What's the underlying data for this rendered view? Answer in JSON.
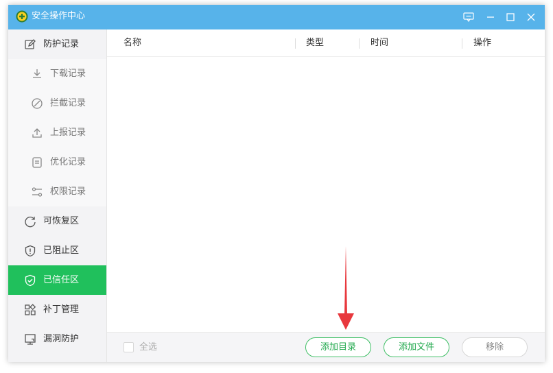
{
  "window": {
    "title": "安全操作中心",
    "colors": {
      "titlebar": "#57b3ea",
      "active": "#20c05c",
      "button_green": "#3fbf65"
    }
  },
  "sidebar": {
    "items": [
      {
        "label": "防护记录",
        "icon": "edit-icon",
        "level": "main"
      },
      {
        "label": "下载记录",
        "icon": "download-icon",
        "level": "sub"
      },
      {
        "label": "拦截记录",
        "icon": "block-icon",
        "level": "sub"
      },
      {
        "label": "上报记录",
        "icon": "upload-icon",
        "level": "sub"
      },
      {
        "label": "优化记录",
        "icon": "document-icon",
        "level": "sub"
      },
      {
        "label": "权限记录",
        "icon": "sliders-icon",
        "level": "sub"
      },
      {
        "label": "可恢复区",
        "icon": "refresh-icon",
        "level": "main"
      },
      {
        "label": "已阻止区",
        "icon": "shield-alert-icon",
        "level": "main"
      },
      {
        "label": "已信任区",
        "icon": "shield-check-icon",
        "level": "main",
        "active": true
      },
      {
        "label": "补丁管理",
        "icon": "apps-grid-icon",
        "level": "main"
      },
      {
        "label": "漏洞防护",
        "icon": "monitor-icon",
        "level": "main"
      }
    ]
  },
  "table": {
    "columns": [
      "名称",
      "类型",
      "时间",
      "操作"
    ],
    "rows": []
  },
  "footer": {
    "select_all": "全选",
    "add_dir": "添加目录",
    "add_file": "添加文件",
    "remove": "移除"
  }
}
